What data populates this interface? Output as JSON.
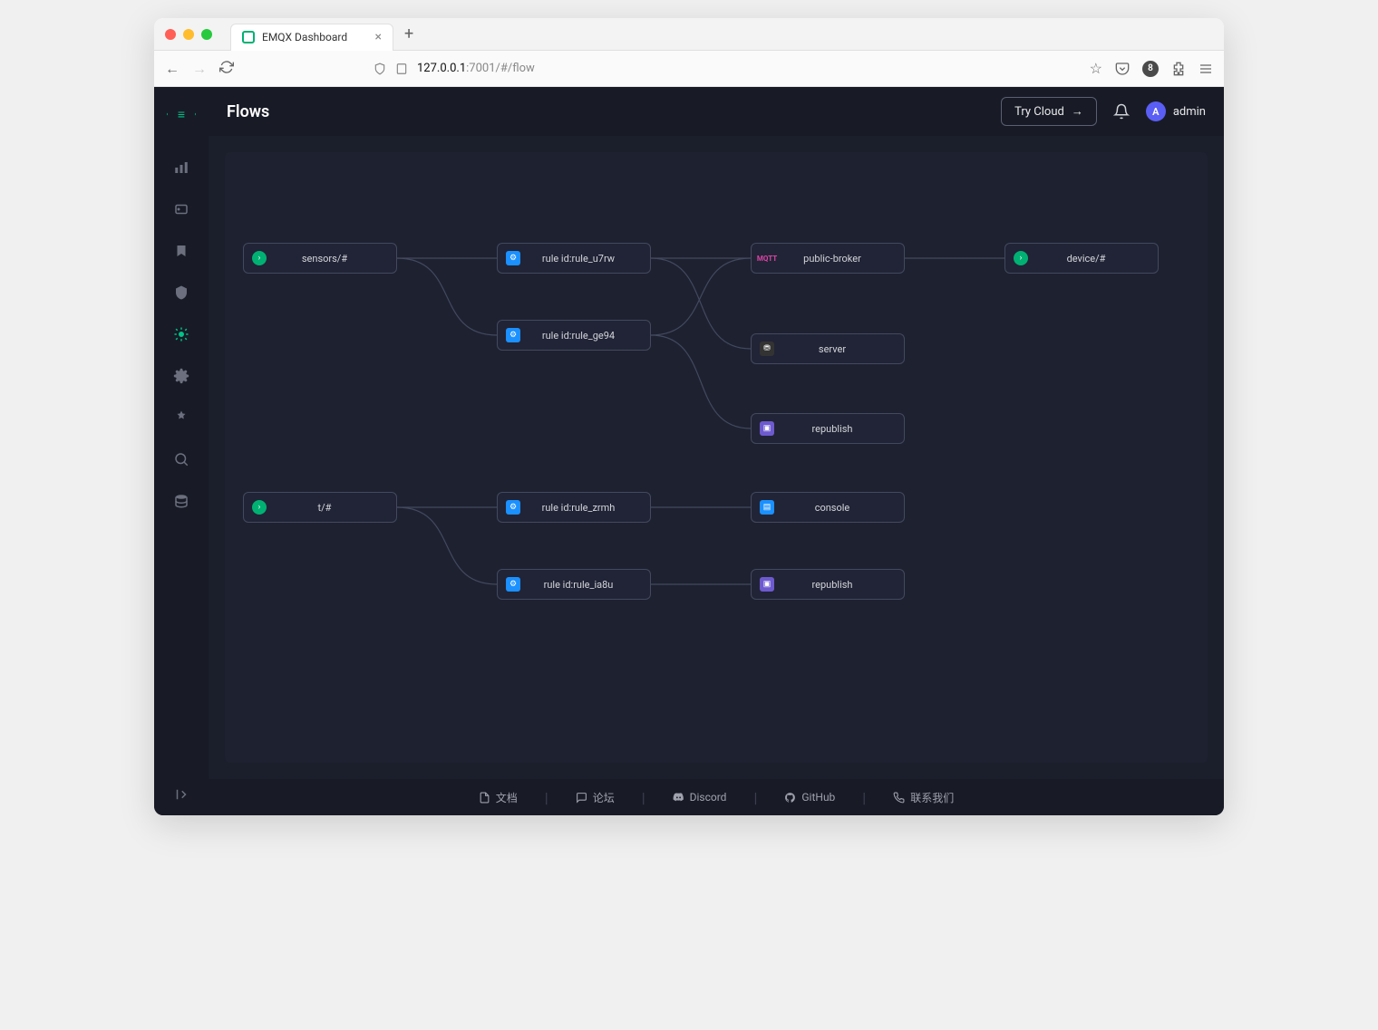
{
  "browser": {
    "tab_title": "EMQX Dashboard",
    "url_host": "127.0.0.1",
    "url_port_path": ":7001/#/flow",
    "badge": "8"
  },
  "header": {
    "title": "Flows",
    "try_cloud_label": "Try Cloud",
    "user_initial": "A",
    "user_name": "admin"
  },
  "nodes": {
    "sensors": {
      "label": "sensors/#",
      "icon": "topic"
    },
    "rule_u7rw": {
      "label": "rule id:rule_u7rw",
      "icon": "rule"
    },
    "rule_ge94": {
      "label": "rule id:rule_ge94",
      "icon": "rule"
    },
    "public_broker": {
      "label": "public-broker",
      "icon": "mqtt",
      "icon_text": "MQTT"
    },
    "server": {
      "label": "server",
      "icon": "http"
    },
    "republish1": {
      "label": "republish",
      "icon": "republish"
    },
    "device": {
      "label": "device/#",
      "icon": "topic"
    },
    "t": {
      "label": "t/#",
      "icon": "topic"
    },
    "rule_zrmh": {
      "label": "rule id:rule_zrmh",
      "icon": "rule"
    },
    "rule_ia8u": {
      "label": "rule id:rule_ia8u",
      "icon": "rule"
    },
    "console": {
      "label": "console",
      "icon": "console"
    },
    "republish2": {
      "label": "republish",
      "icon": "republish"
    }
  },
  "footer": {
    "docs": "文档",
    "forum": "论坛",
    "discord": "Discord",
    "github": "GitHub",
    "contact": "联系我们"
  }
}
